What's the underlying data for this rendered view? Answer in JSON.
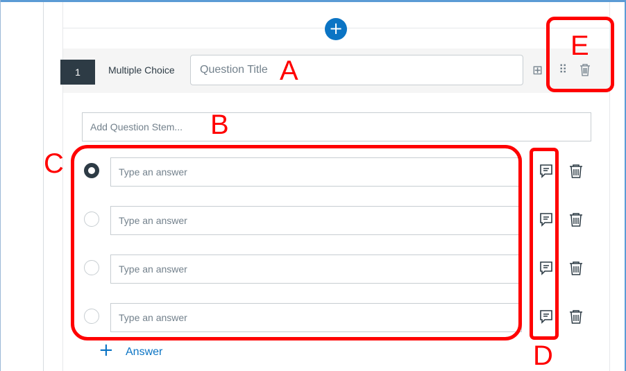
{
  "add_question_symbol": "+",
  "question": {
    "number": "1",
    "type": "Multiple Choice",
    "title_placeholder": "Question Title",
    "title_value": "",
    "stem_placeholder": "Add Question Stem...",
    "stem_value": ""
  },
  "header_actions": [
    {
      "name": "duplicate-icon",
      "glyph": "⊞"
    },
    {
      "name": "drag-handle-icon",
      "glyph": "⠿"
    },
    {
      "name": "trash-icon",
      "glyph": "🗑"
    }
  ],
  "answers": [
    {
      "placeholder": "Type an answer",
      "value": "",
      "selected": true
    },
    {
      "placeholder": "Type an answer",
      "value": "",
      "selected": false
    },
    {
      "placeholder": "Type an answer",
      "value": "",
      "selected": false
    },
    {
      "placeholder": "Type an answer",
      "value": "",
      "selected": false
    }
  ],
  "row_actions": [
    "feedback-comment-icon",
    "trash-icon"
  ],
  "add_answer": {
    "symbol": "+",
    "label": "Answer"
  },
  "annotations": {
    "A": "A",
    "B": "B",
    "C": "C",
    "D": "D",
    "E": "E",
    "color": "#ff0000"
  },
  "colors": {
    "accent_blue": "#0b74c4",
    "dark": "#2d3b45",
    "icon_gray": "#73818c",
    "border_gray": "#c7cdd1"
  }
}
